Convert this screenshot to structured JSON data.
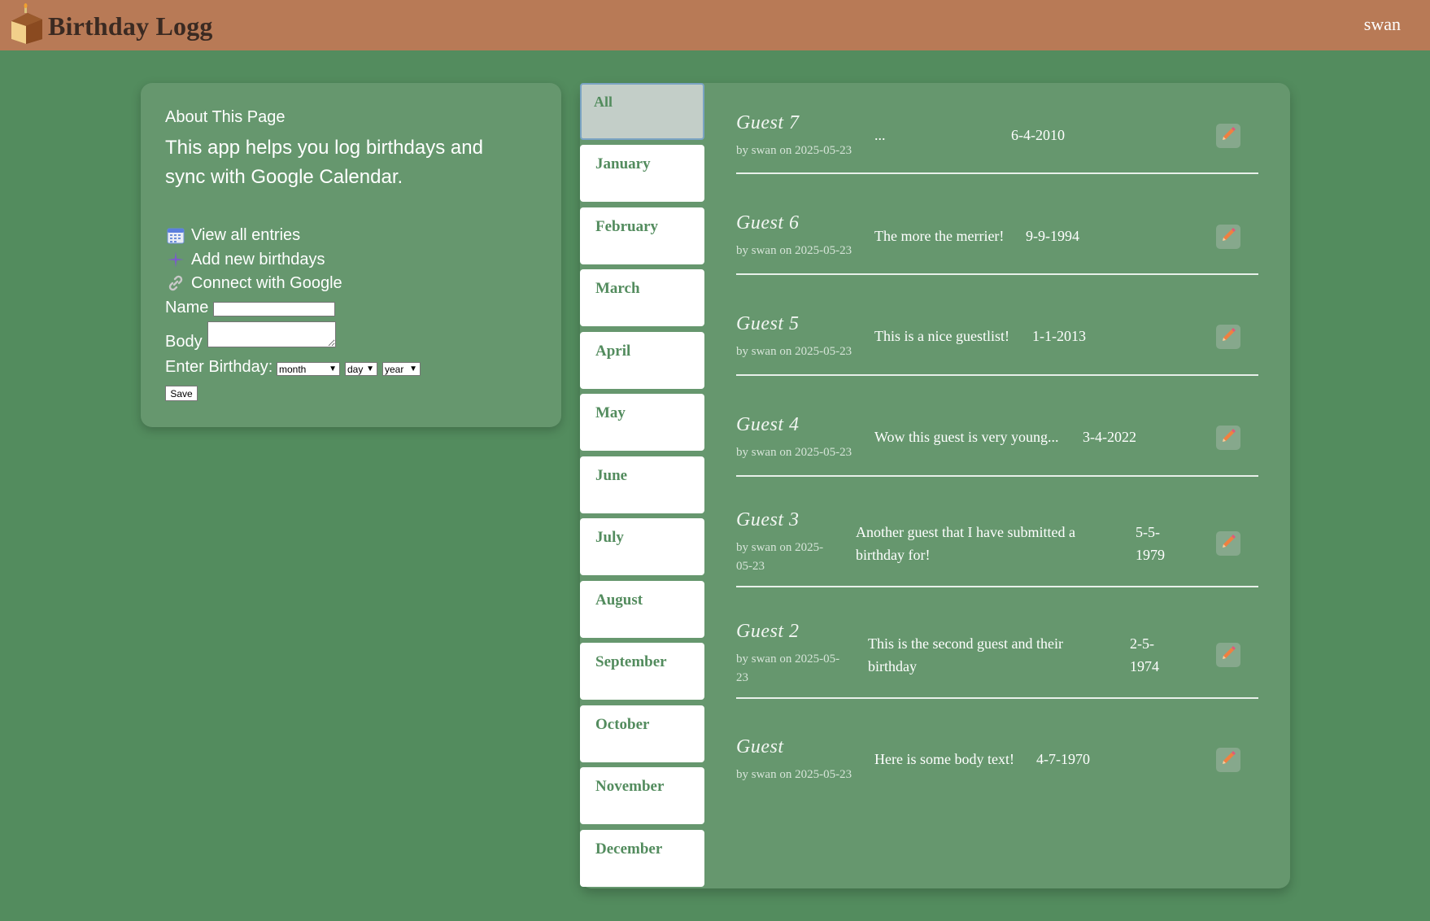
{
  "header": {
    "title": "Birthday Logg",
    "user": "swan",
    "logo_letters": "BDAY"
  },
  "about": {
    "title": "About This Page",
    "description": "This app helps you log birthdays and sync with Google Calendar.",
    "links": [
      {
        "label": "View all entries",
        "icon": "calendar-icon"
      },
      {
        "label": "Add new birthdays",
        "icon": "plus-icon"
      },
      {
        "label": "Connect with Google",
        "icon": "link-icon"
      }
    ],
    "form": {
      "name_label": "Name",
      "name_value": "",
      "body_label": "Body",
      "body_value": "",
      "birthday_label": "Enter Birthday:",
      "month_select": "month",
      "day_select": "day",
      "year_select": "year",
      "save_label": "Save"
    }
  },
  "months": [
    "All",
    "January",
    "February",
    "March",
    "April",
    "May",
    "June",
    "July",
    "August",
    "September",
    "October",
    "November",
    "December"
  ],
  "active_month": "All",
  "entries": [
    {
      "name": "Guest 7",
      "meta": "by swan on 2025-05-23",
      "body": "...",
      "date": "6-4-2010"
    },
    {
      "name": "Guest 6",
      "meta": "by swan on 2025-05-23",
      "body": "The more the merrier!",
      "date": "9-9-1994"
    },
    {
      "name": "Guest 5",
      "meta": "by swan on 2025-05-23",
      "body": "This is a nice guestlist!",
      "date": "1-1-2013"
    },
    {
      "name": "Guest 4",
      "meta": "by swan on 2025-05-23",
      "body": "Wow this guest is very young...",
      "date": "3-4-2022"
    },
    {
      "name": "Guest 3",
      "meta": "by swan on 2025-05-23",
      "body": "Another guest that I have submitted a birthday for!",
      "date": "5-5-1979"
    },
    {
      "name": "Guest 2",
      "meta": "by swan on 2025-05-23",
      "body": "This is the second guest and their birthday",
      "date": "2-5-1974"
    },
    {
      "name": "Guest",
      "meta": "by swan on 2025-05-23",
      "body": "Here is some body text!",
      "date": "4-7-1970"
    }
  ],
  "colors": {
    "header": "#b87a56",
    "background": "#538c5e",
    "panel": "#66976e",
    "accent_text": "#538c5e"
  }
}
